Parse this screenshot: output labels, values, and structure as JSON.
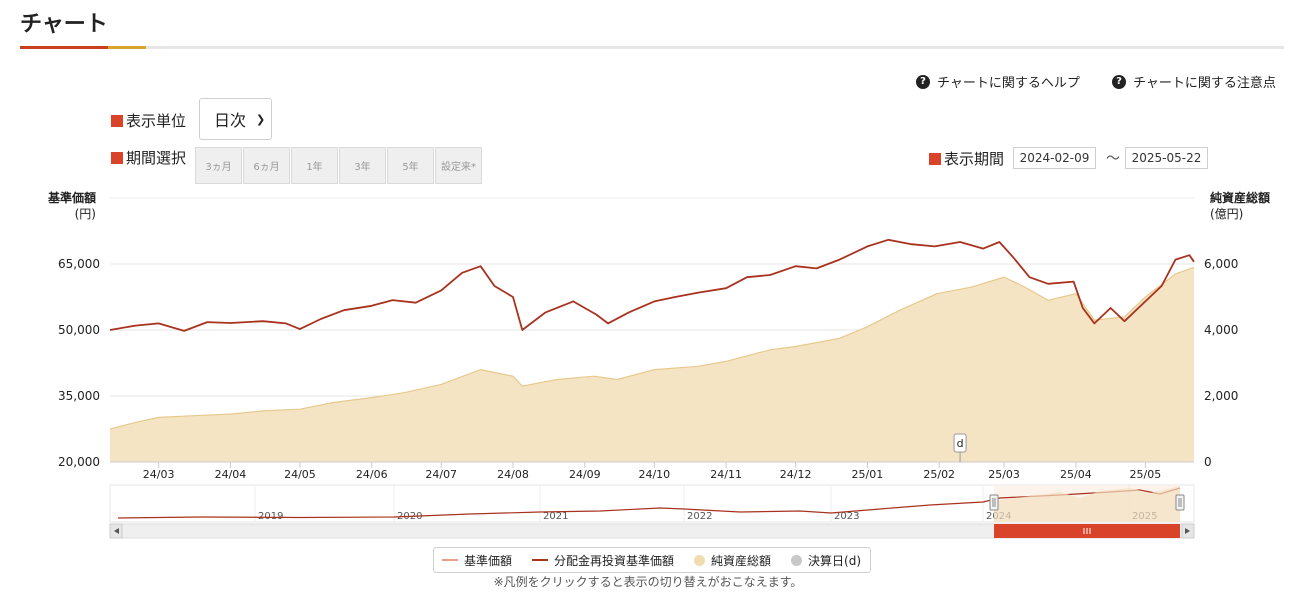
{
  "header": {
    "title": "チャート"
  },
  "help_links": [
    {
      "label": "チャートに関するヘルプ",
      "icon": "question-circle-icon"
    },
    {
      "label": "チャートに関する注意点",
      "icon": "question-circle-icon"
    }
  ],
  "controls": {
    "unit_label": "表示単位",
    "unit_value": "日次",
    "period_label": "期間選択",
    "period_buttons": [
      "3ヵ月",
      "6ヵ月",
      "1年",
      "3年",
      "5年",
      "設定来*"
    ],
    "range_label": "表示期間",
    "range_start": "2024-02-09",
    "range_sep": "〜",
    "range_end": "2025-05-22"
  },
  "legend_note": "※凡例をクリックすると表示の切り替えがおこなえます。",
  "colors": {
    "accent": "#d8432a",
    "nav_line": "#a8321e",
    "base_line": "#e8a08a",
    "net_assets_fill": "#f5e4c3",
    "net_assets_stroke": "#e6c98e",
    "settlement": "#c8c8c8"
  },
  "chart_data": {
    "type": "line",
    "y_left": {
      "title": "基準価額",
      "unit": "(円)",
      "ticks": [
        "65,000",
        "50,000",
        "35,000",
        "20,000"
      ],
      "range": [
        20000,
        65000
      ]
    },
    "y_right": {
      "title": "純資産総額",
      "unit": "(億円)",
      "ticks": [
        "6,000",
        "4,000",
        "2,000",
        "0"
      ],
      "range": [
        0,
        6000
      ]
    },
    "x_ticks": [
      "24/03",
      "24/04",
      "24/05",
      "24/06",
      "24/07",
      "24/08",
      "24/09",
      "24/10",
      "24/11",
      "24/12",
      "25/01",
      "25/02",
      "25/03",
      "25/04",
      "25/05"
    ],
    "series": [
      {
        "name": "基準価額",
        "axis": "left",
        "visible": false
      },
      {
        "name": "分配金再投資基準価額",
        "axis": "left",
        "points": [
          [
            "2024-02-09",
            50000
          ],
          [
            "2024-02-20",
            51000
          ],
          [
            "2024-03-01",
            51500
          ],
          [
            "2024-03-12",
            49800
          ],
          [
            "2024-03-22",
            51800
          ],
          [
            "2024-04-01",
            51600
          ],
          [
            "2024-04-15",
            52000
          ],
          [
            "2024-04-25",
            51500
          ],
          [
            "2024-05-01",
            50200
          ],
          [
            "2024-05-10",
            52500
          ],
          [
            "2024-05-20",
            54500
          ],
          [
            "2024-06-01",
            55500
          ],
          [
            "2024-06-10",
            56800
          ],
          [
            "2024-06-20",
            56200
          ],
          [
            "2024-07-01",
            59000
          ],
          [
            "2024-07-10",
            63000
          ],
          [
            "2024-07-18",
            64500
          ],
          [
            "2024-07-24",
            60000
          ],
          [
            "2024-08-01",
            57500
          ],
          [
            "2024-08-05",
            50000
          ],
          [
            "2024-08-15",
            54000
          ],
          [
            "2024-08-27",
            56500
          ],
          [
            "2024-09-06",
            53500
          ],
          [
            "2024-09-11",
            51500
          ],
          [
            "2024-09-20",
            54000
          ],
          [
            "2024-10-01",
            56500
          ],
          [
            "2024-10-10",
            57500
          ],
          [
            "2024-10-20",
            58500
          ],
          [
            "2024-11-01",
            59500
          ],
          [
            "2024-11-10",
            62000
          ],
          [
            "2024-11-20",
            62500
          ],
          [
            "2024-12-01",
            64500
          ],
          [
            "2024-12-10",
            64000
          ],
          [
            "2024-12-20",
            66000
          ],
          [
            "2025-01-01",
            69000
          ],
          [
            "2025-01-10",
            70500
          ],
          [
            "2025-01-20",
            69500
          ],
          [
            "2025-01-30",
            69000
          ],
          [
            "2025-02-10",
            70000
          ],
          [
            "2025-02-20",
            68500
          ],
          [
            "2025-02-27",
            70000
          ],
          [
            "2025-03-05",
            66500
          ],
          [
            "2025-03-12",
            62000
          ],
          [
            "2025-03-20",
            60500
          ],
          [
            "2025-03-31",
            61000
          ],
          [
            "2025-04-04",
            55000
          ],
          [
            "2025-04-09",
            51500
          ],
          [
            "2025-04-16",
            55000
          ],
          [
            "2025-04-22",
            52000
          ],
          [
            "2025-04-30",
            56000
          ],
          [
            "2025-05-08",
            60000
          ],
          [
            "2025-05-14",
            66000
          ],
          [
            "2025-05-20",
            67000
          ],
          [
            "2025-05-22",
            65500
          ]
        ]
      },
      {
        "name": "純資産総額",
        "axis": "right",
        "points": [
          [
            "2024-02-09",
            1000
          ],
          [
            "2024-02-20",
            1200
          ],
          [
            "2024-03-01",
            1350
          ],
          [
            "2024-03-15",
            1400
          ],
          [
            "2024-04-01",
            1450
          ],
          [
            "2024-04-15",
            1550
          ],
          [
            "2024-05-01",
            1600
          ],
          [
            "2024-05-15",
            1800
          ],
          [
            "2024-06-01",
            1950
          ],
          [
            "2024-06-15",
            2100
          ],
          [
            "2024-07-01",
            2350
          ],
          [
            "2024-07-18",
            2800
          ],
          [
            "2024-08-01",
            2600
          ],
          [
            "2024-08-05",
            2300
          ],
          [
            "2024-08-20",
            2500
          ],
          [
            "2024-09-05",
            2600
          ],
          [
            "2024-09-15",
            2500
          ],
          [
            "2024-10-01",
            2800
          ],
          [
            "2024-10-20",
            2900
          ],
          [
            "2024-11-01",
            3050
          ],
          [
            "2024-11-20",
            3400
          ],
          [
            "2024-12-01",
            3500
          ],
          [
            "2024-12-20",
            3750
          ],
          [
            "2025-01-01",
            4100
          ],
          [
            "2025-01-15",
            4600
          ],
          [
            "2025-01-31",
            5100
          ],
          [
            "2025-02-15",
            5300
          ],
          [
            "2025-03-01",
            5600
          ],
          [
            "2025-03-10",
            5300
          ],
          [
            "2025-03-20",
            4900
          ],
          [
            "2025-04-01",
            5100
          ],
          [
            "2025-04-09",
            4300
          ],
          [
            "2025-04-22",
            4400
          ],
          [
            "2025-05-01",
            5000
          ],
          [
            "2025-05-14",
            5700
          ],
          [
            "2025-05-22",
            5900
          ]
        ]
      },
      {
        "name": "決算日(d)",
        "markers": [
          {
            "date": "2025-02-10",
            "label": "d"
          }
        ]
      }
    ],
    "navigator": {
      "years": [
        "2019",
        "2020",
        "2021",
        "2022",
        "2023",
        "2024",
        "2025"
      ]
    }
  }
}
